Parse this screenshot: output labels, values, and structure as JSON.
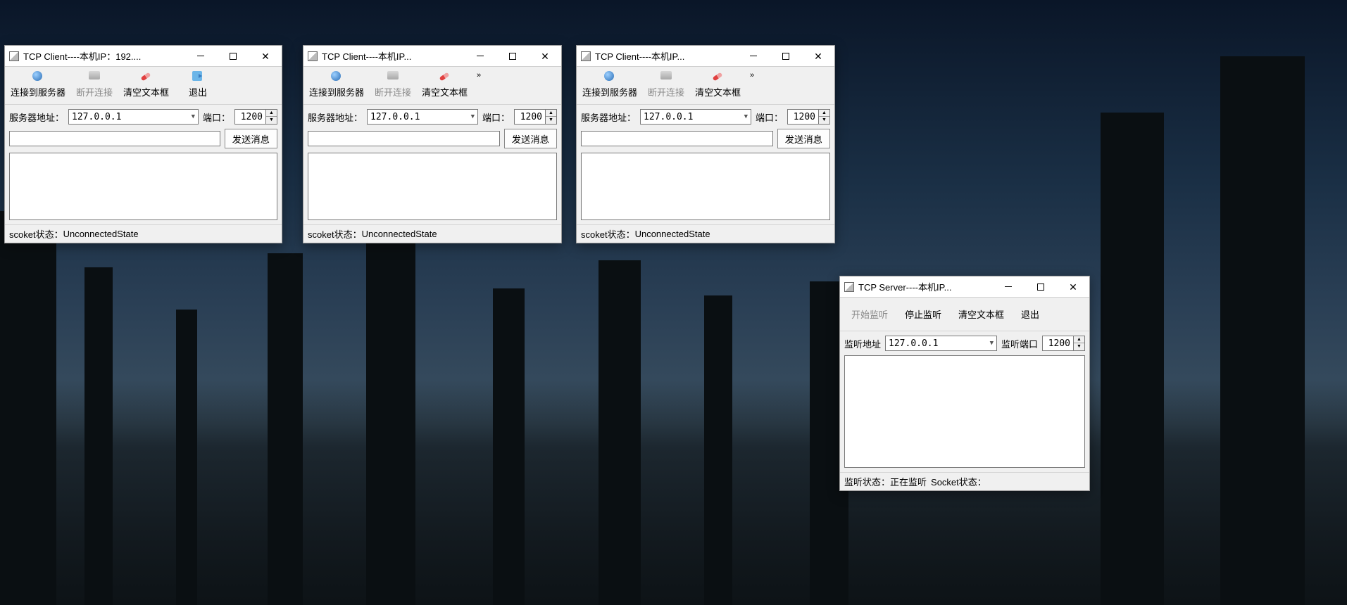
{
  "windows": {
    "client1": {
      "title": "TCP Client----本机IP：192...."
    },
    "client2": {
      "title": "TCP Client----本机IP..."
    },
    "client3": {
      "title": "TCP Client----本机IP..."
    },
    "server": {
      "title": "TCP Server----本机IP..."
    }
  },
  "toolbar": {
    "connect": "连接到服务器",
    "disconnect": "断开连接",
    "clear": "清空文本框",
    "exit": "退出",
    "overflow": "»"
  },
  "server_toolbar": {
    "start": "开始监听",
    "stop": "停止监听",
    "clear": "清空文本框",
    "exit": "退出"
  },
  "form": {
    "server_addr_label": "服务器地址：",
    "server_addr": "127.0.0.1",
    "port_label": "端口：",
    "port": "1200",
    "send": "发送消息",
    "listen_addr_label": "监听地址",
    "listen_addr": "127.0.0.1",
    "listen_port_label": "监听端口",
    "listen_port": "1200"
  },
  "status": {
    "socket_label": "scoket状态：",
    "socket_state": "UnconnectedState",
    "listen_label": "监听状态：",
    "listen_state": "正在监听",
    "sock_label": "Socket状态："
  }
}
